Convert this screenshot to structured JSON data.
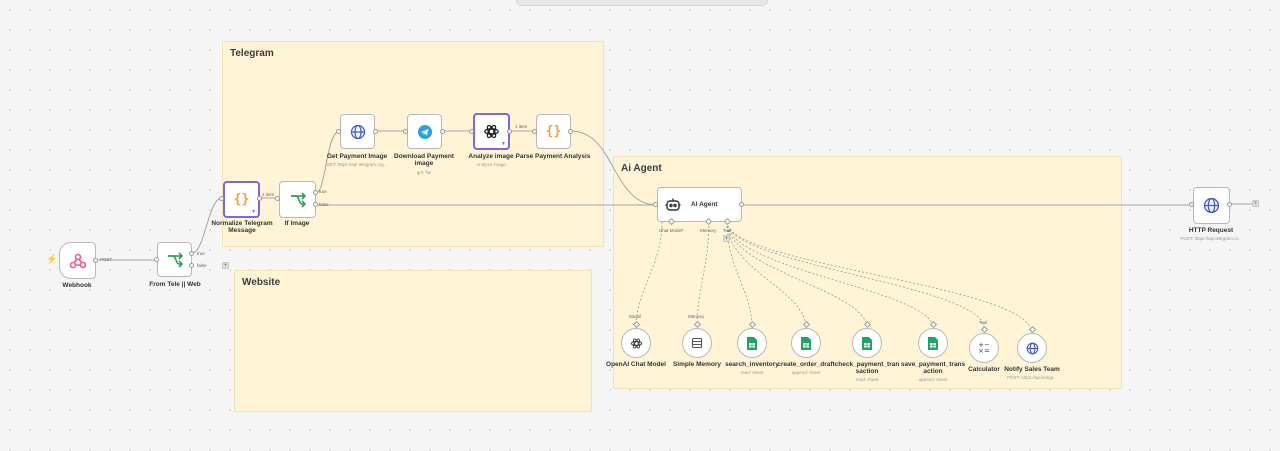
{
  "groups": {
    "telegram": "Telegram",
    "website": "Website",
    "ai_agent": "Ai Agent"
  },
  "nodes": {
    "webhook": {
      "label": "Webhook"
    },
    "from_tele_web": {
      "label": "From Tele || Web"
    },
    "normalize": {
      "label": "Normalize Telegram Message"
    },
    "if_image": {
      "label": "If Image"
    },
    "get_payment_image": {
      "label": "Get Payment Image",
      "sub": "GET: https://api.telegram.org..."
    },
    "download_payment_image": {
      "label": "Download Payment image",
      "sub": "get: file"
    },
    "analyze_image": {
      "label": "Analyze image",
      "sub": "Analyze image"
    },
    "parse_payment_analysis": {
      "label": "Parse Payment Analysis"
    },
    "ai_agent": {
      "label": "AI Agent"
    },
    "http_request": {
      "label": "HTTP Request",
      "sub": "POST: https://api.telegram.or..."
    },
    "openai_chat_model": {
      "label": "OpenAI Chat Model"
    },
    "simple_memory": {
      "label": "Simple Memory"
    },
    "search_inventory": {
      "label": "search_inventory",
      "sub": "read: sheet"
    },
    "create_order_draft": {
      "label": "create_order_draft",
      "sub": "append: sheet"
    },
    "check_payment_transaction": {
      "label": "check_payment_tran saction",
      "sub": "read: sheet"
    },
    "save_payment_transaction": {
      "label": "save_payment_trans action",
      "sub": "append: sheet"
    },
    "calculator": {
      "label": "Calculator"
    },
    "notify_sales_team": {
      "label": "Notify Sales Team",
      "sub": "POST: https://api.telegr..."
    }
  },
  "connection_labels": {
    "post": "POST",
    "true": "true",
    "false": "false",
    "one_item": "1 item",
    "chat_model": "Chat Model*",
    "memory": "Memory",
    "tool": "Tool",
    "model": "Model"
  },
  "colors": {
    "sticky": "#fff5d6",
    "accent": "#7a6ad8",
    "webhook": "#e85d8b",
    "if_green": "#2e9d5b",
    "set_orange": "#f0a233",
    "http_blue": "#3f5bd8",
    "telegram": "#2aa3df",
    "sheets": "#1fa463"
  },
  "icons": {
    "webhook": "webhook-icon",
    "if": "branch-icon",
    "set": "braces-icon",
    "http": "globe-icon",
    "telegram": "telegram-icon",
    "openai": "openai-icon",
    "agent": "robot-icon",
    "memory": "database-icon",
    "sheets": "sheet-icon",
    "calculator": "calculator-icon",
    "trigger": "lightning-icon"
  }
}
